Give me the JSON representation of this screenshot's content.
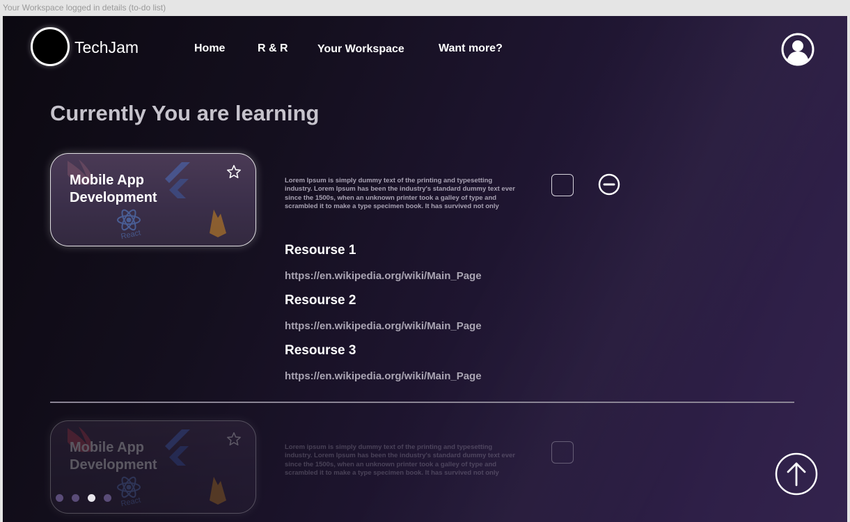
{
  "frame_label": "Your Workspace logged in details (to-do list)",
  "brand": {
    "name": "TechJam"
  },
  "nav": {
    "items": [
      {
        "label": "Home"
      },
      {
        "label": "R & R"
      },
      {
        "label": "Your Workspace"
      },
      {
        "label": "Want more?"
      }
    ]
  },
  "page_title": "Currently You are learning",
  "courses": [
    {
      "title": "Mobile App Development",
      "title_line1": "Mobile App",
      "title_line2": "Development",
      "logo_labels": {
        "react": "React"
      },
      "description": "Lorem Ipsum is simply dummy text of the printing and typesetting industry. Lorem Ipsum has been the industry's standard dummy text ever since the 1500s, when an unknown printer took a galley of type and scrambled it to make a type specimen book. It has survived not only",
      "resources": [
        {
          "title": "Resourse 1",
          "url": "https://en.wikipedia.org/wiki/Main_Page"
        },
        {
          "title": "Resourse 2",
          "url": "https://en.wikipedia.org/wiki/Main_Page"
        },
        {
          "title": "Resourse 3",
          "url": "https://en.wikipedia.org/wiki/Main_Page"
        }
      ]
    },
    {
      "title": "Mobile App Development",
      "title_line1": "Mobile App",
      "title_line2": "Development",
      "logo_labels": {
        "react": "React"
      },
      "description": "Lorem ipsum is simply dummy text of the printing and typesetting industry. Lorem Ipsum has been the industry's standard dummy text ever since the 1500s, when an unknown printer took a galley of type and scrambled it to make a type specimen book. It has survived not only"
    }
  ],
  "carousel": {
    "count": 4,
    "active_index": 2
  },
  "icons": {
    "avatar": "user-circle-icon",
    "star": "star-outline-icon",
    "remove": "minus-circle-icon",
    "scroll_top": "arrow-up-circle-icon"
  },
  "colors": {
    "background_start": "#0c0911",
    "background_end": "#33234d",
    "title": "#c6c3cc",
    "link": "#aaa5b3"
  }
}
